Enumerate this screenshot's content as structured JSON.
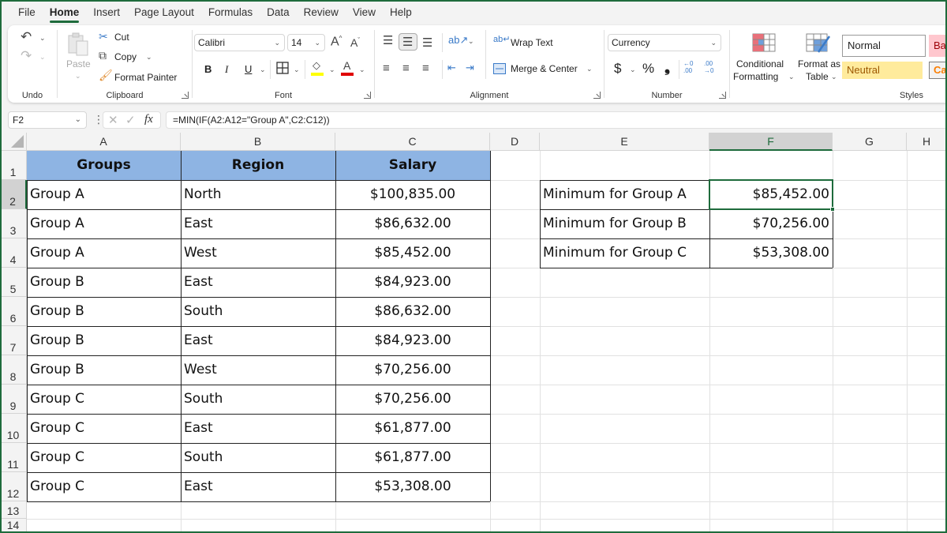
{
  "menu": {
    "tabs": [
      "File",
      "Home",
      "Insert",
      "Page Layout",
      "Formulas",
      "Data",
      "Review",
      "View",
      "Help"
    ],
    "active_tab": "Home"
  },
  "ribbon": {
    "undo": {
      "group_label": "Undo"
    },
    "clipboard": {
      "paste_label": "Paste",
      "cut_label": "Cut",
      "copy_label": "Copy",
      "format_painter_label": "Format Painter",
      "group_label": "Clipboard"
    },
    "font": {
      "font_name": "Calibri",
      "font_size": "14",
      "bold": "B",
      "italic": "I",
      "underline": "U",
      "group_label": "Font",
      "fill_color": "#ffff00",
      "font_color": "#e00000"
    },
    "alignment": {
      "wrap_text_label": "Wrap Text",
      "merge_center_label": "Merge & Center",
      "group_label": "Alignment"
    },
    "number": {
      "format": "Currency",
      "dollar": "$",
      "percent": "%",
      "comma": "❟",
      "inc_decimal": "←0 .00",
      "dec_decimal": ".00 →0",
      "group_label": "Number"
    },
    "styles": {
      "conditional_formatting_line1": "Conditional",
      "conditional_formatting_line2": "Formatting",
      "format_as_table_line1": "Format as",
      "format_as_table_line2": "Table",
      "normal": "Normal",
      "bad": "Bad",
      "neutral": "Neutral",
      "calculation": "Calc",
      "group_label": "Styles"
    }
  },
  "formula_bar": {
    "name_box": "F2",
    "fx_label": "fx",
    "formula": "=MIN(IF(A2:A12=\"Group A\",C2:C12))"
  },
  "sheet": {
    "columns": [
      "A",
      "B",
      "C",
      "D",
      "E",
      "F",
      "G",
      "H"
    ],
    "selected_column": "F",
    "rows": [
      "1",
      "2",
      "3",
      "4",
      "5",
      "6",
      "7",
      "8",
      "9",
      "10",
      "11",
      "12",
      "13",
      "14"
    ],
    "selected_row": "2",
    "active_cell": "F2",
    "table": {
      "headers": [
        "Groups",
        "Region",
        "Salary"
      ],
      "header_fill": "#8eb4e3",
      "rows": [
        [
          "Group A",
          "North",
          "$100,835.00"
        ],
        [
          "Group A",
          "East",
          "$86,632.00"
        ],
        [
          "Group A",
          "West",
          "$85,452.00"
        ],
        [
          "Group B",
          "East",
          "$84,923.00"
        ],
        [
          "Group B",
          "South",
          "$86,632.00"
        ],
        [
          "Group B",
          "East",
          "$84,923.00"
        ],
        [
          "Group B",
          "West",
          "$70,256.00"
        ],
        [
          "Group C",
          "South",
          "$70,256.00"
        ],
        [
          "Group C",
          "East",
          "$61,877.00"
        ],
        [
          "Group C",
          "South",
          "$61,877.00"
        ],
        [
          "Group C",
          "East",
          "$53,308.00"
        ]
      ]
    },
    "summary": [
      {
        "label": "Minimum for Group A",
        "value": "$85,452.00"
      },
      {
        "label": "Minimum for Group B",
        "value": "$70,256.00"
      },
      {
        "label": "Minimum for Group C",
        "value": "$53,308.00"
      }
    ]
  }
}
